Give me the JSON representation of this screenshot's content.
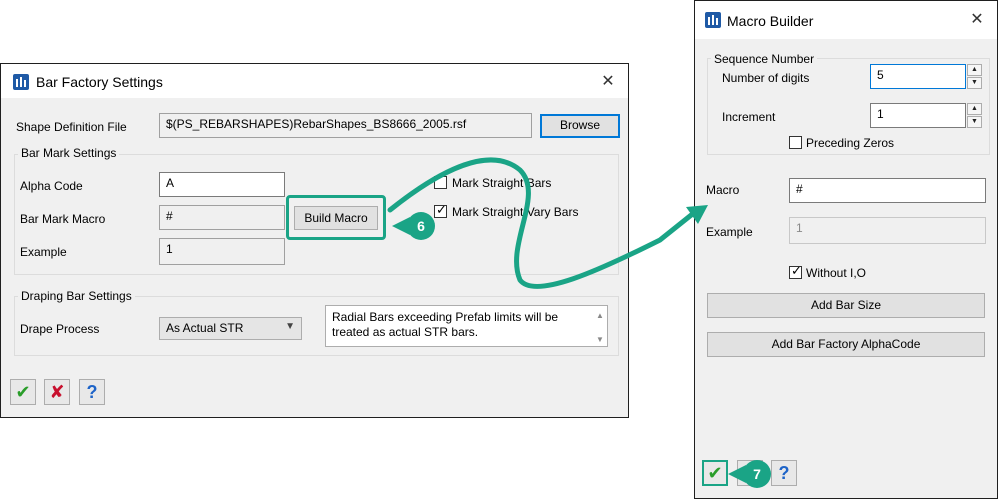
{
  "bar_factory": {
    "title": "Bar Factory Settings",
    "shape_definition_label": "Shape Definition File",
    "shape_definition_value": "$(PS_REBARSHAPES)RebarShapes_BS8666_2005.rsf",
    "browse_label": "Browse",
    "bar_mark_group": "Bar Mark Settings",
    "alpha_code_label": "Alpha Code",
    "alpha_code_value": "A",
    "bar_mark_macro_label": "Bar Mark Macro",
    "bar_mark_macro_value": "#",
    "build_macro_label": "Build Macro",
    "example_label": "Example",
    "example_value": "1",
    "mark_straight_label": "Mark Straight Bars",
    "mark_straight_checked": false,
    "mark_straight_vary_label": "Mark Straight Vary Bars",
    "mark_straight_vary_checked": true,
    "draping_group": "Draping Bar Settings",
    "drape_process_label": "Drape Process",
    "drape_process_value": "As Actual STR",
    "drape_note_line1": "Radial Bars exceeding Prefab limits will be",
    "drape_note_line2": "treated as actual STR bars."
  },
  "macro_builder": {
    "title": "Macro Builder",
    "sequence_group": "Sequence Number",
    "digits_label": "Number of digits",
    "digits_value": "5",
    "increment_label": "Increment",
    "increment_value": "1",
    "preceding_zeros_label": "Preceding Zeros",
    "preceding_zeros_checked": false,
    "macro_label": "Macro",
    "macro_value": "#",
    "example_label": "Example",
    "example_value": "1",
    "without_io_label": "Without I,O",
    "without_io_checked": true,
    "add_bar_size_label": "Add Bar Size",
    "add_alpha_label": "Add Bar Factory AlphaCode"
  },
  "callouts": {
    "step6": "6",
    "step7": "7"
  },
  "icons": {
    "ok": "checkmark-icon",
    "cancel": "cross-icon",
    "help": "question-icon"
  },
  "colors": {
    "accent": "#1aa486",
    "focus": "#0078d7",
    "ok_green": "#2a9d2a",
    "cancel_red": "#c8102e",
    "help_blue": "#1e64c8"
  }
}
